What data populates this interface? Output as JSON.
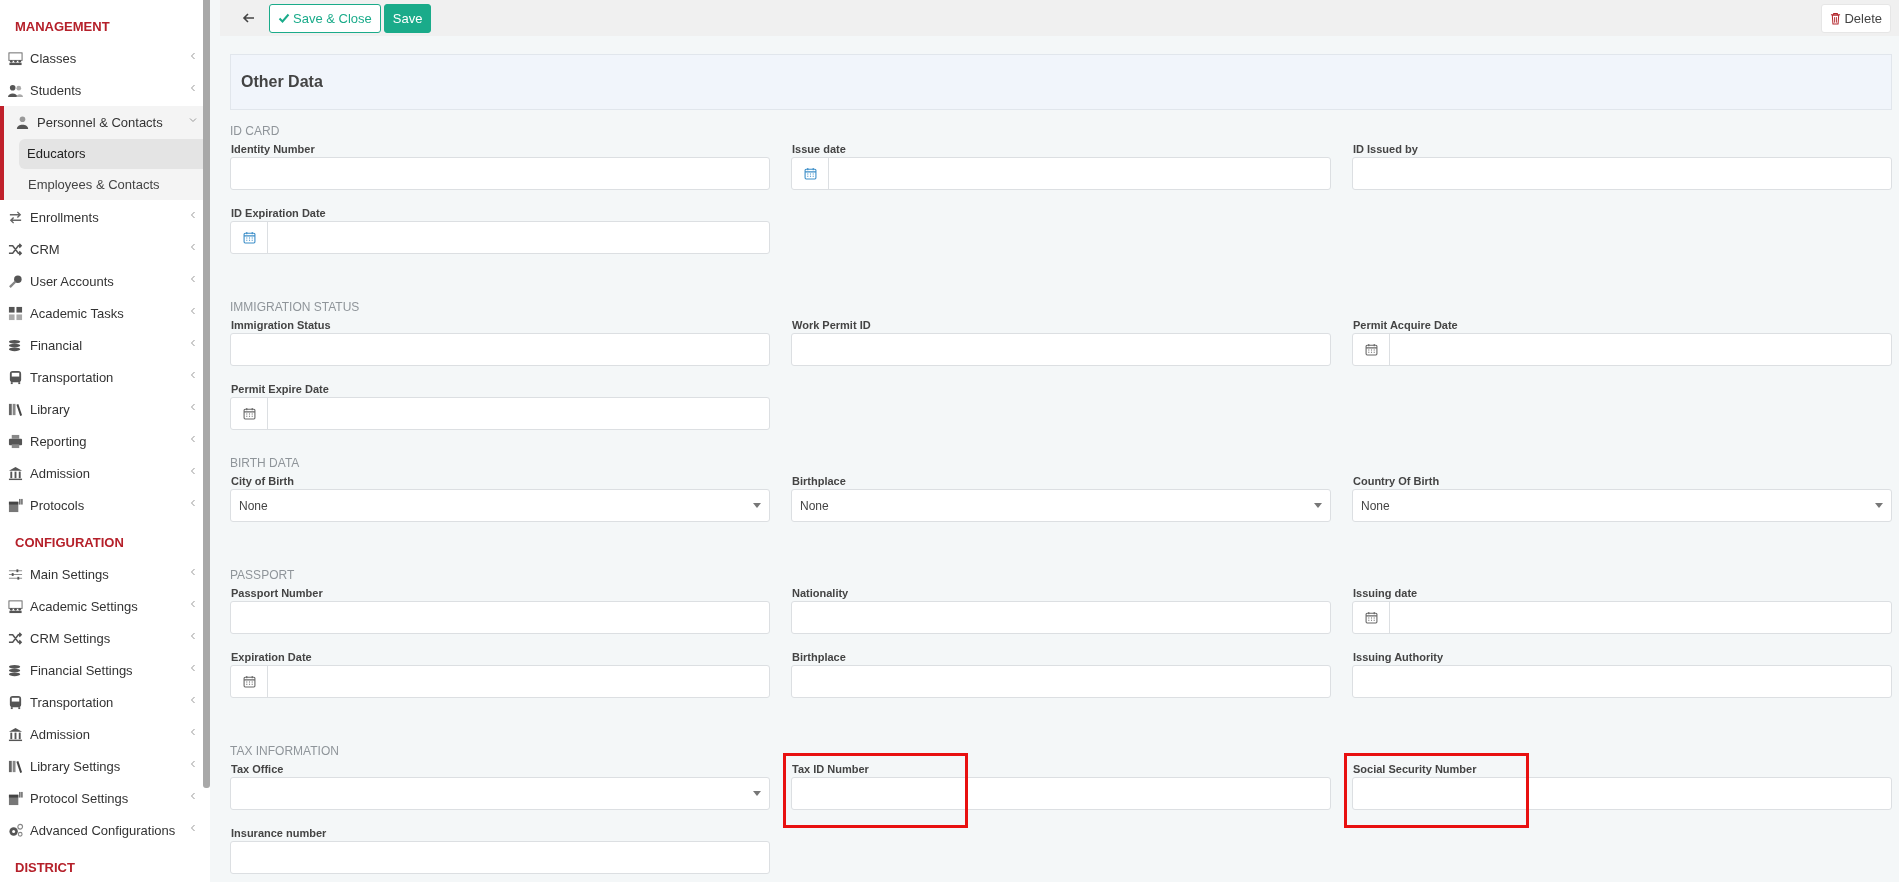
{
  "sidebar": {
    "groups": [
      {
        "heading": "MANAGEMENT",
        "items": [
          {
            "label": "Classes",
            "expanded": false
          },
          {
            "label": "Students",
            "expanded": false
          },
          {
            "label": "Personnel & Contacts",
            "expanded": true,
            "children": [
              {
                "label": "Educators",
                "selected": true
              },
              {
                "label": "Employees & Contacts",
                "selected": false
              }
            ]
          },
          {
            "label": "Enrollments",
            "expanded": false
          },
          {
            "label": "CRM",
            "expanded": false
          },
          {
            "label": "User Accounts",
            "expanded": false
          },
          {
            "label": "Academic Tasks",
            "expanded": false
          },
          {
            "label": "Financial",
            "expanded": false
          },
          {
            "label": "Transportation",
            "expanded": false
          },
          {
            "label": "Library",
            "expanded": false
          },
          {
            "label": "Reporting",
            "expanded": false
          },
          {
            "label": "Admission",
            "expanded": false
          },
          {
            "label": "Protocols",
            "expanded": false
          }
        ]
      },
      {
        "heading": "CONFIGURATION",
        "items": [
          {
            "label": "Main Settings",
            "expanded": false
          },
          {
            "label": "Academic Settings",
            "expanded": false
          },
          {
            "label": "CRM Settings",
            "expanded": false
          },
          {
            "label": "Financial Settings",
            "expanded": false
          },
          {
            "label": "Transportation",
            "expanded": false
          },
          {
            "label": "Admission",
            "expanded": false
          },
          {
            "label": "Library Settings",
            "expanded": false
          },
          {
            "label": "Protocol Settings",
            "expanded": false
          },
          {
            "label": "Advanced Configurations",
            "expanded": false
          }
        ]
      },
      {
        "heading": "DISTRICT"
      }
    ]
  },
  "toolbar": {
    "save_close": "Save & Close",
    "save": "Save",
    "delete": "Delete"
  },
  "panel_title": "Other Data",
  "sections": [
    {
      "title": "ID CARD",
      "fields": [
        {
          "label": "Identity Number",
          "kind": "text"
        },
        {
          "label": "Issue date",
          "kind": "date"
        },
        {
          "label": "ID Issued by",
          "kind": "text"
        },
        {
          "label": "ID Expiration Date",
          "kind": "date"
        }
      ]
    },
    {
      "title": "IMMIGRATION STATUS",
      "fields": [
        {
          "label": "Immigration Status",
          "kind": "text"
        },
        {
          "label": "Work Permit ID",
          "kind": "text"
        },
        {
          "label": "Permit Acquire Date",
          "kind": "date"
        },
        {
          "label": "Permit Expire Date",
          "kind": "date"
        }
      ]
    },
    {
      "title": "BIRTH DATA",
      "fields": [
        {
          "label": "City of Birth",
          "kind": "select",
          "value": "None"
        },
        {
          "label": "Birthplace",
          "kind": "select",
          "value": "None"
        },
        {
          "label": "Country Of Birth",
          "kind": "select",
          "value": "None"
        }
      ]
    },
    {
      "title": "PASSPORT",
      "fields": [
        {
          "label": "Passport Number",
          "kind": "text"
        },
        {
          "label": "Nationality",
          "kind": "text"
        },
        {
          "label": "Issuing date",
          "kind": "date"
        },
        {
          "label": "Expiration Date",
          "kind": "date"
        },
        {
          "label": "Birthplace",
          "kind": "text"
        },
        {
          "label": "Issuing Authority",
          "kind": "text"
        }
      ]
    },
    {
      "title": "TAX INFORMATION",
      "fields": [
        {
          "label": "Tax Office",
          "kind": "select"
        },
        {
          "label": "Tax ID Number",
          "kind": "text",
          "highlighted": true
        },
        {
          "label": "Social Security Number",
          "kind": "text",
          "highlighted": true
        },
        {
          "label": "Insurance number",
          "kind": "text"
        }
      ]
    }
  ]
}
